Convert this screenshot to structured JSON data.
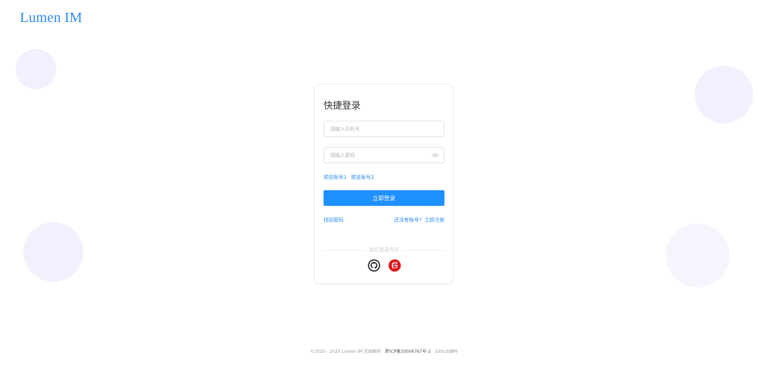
{
  "app": {
    "logo": "Lumen IM"
  },
  "login_card": {
    "title": "快捷登录",
    "phone_placeholder": "请输入手机号",
    "password_placeholder": "请输入密码",
    "preview_accounts": [
      "预览账号1",
      "预览账号2"
    ],
    "login_button": "立即登录",
    "forgot_password": "找回密码",
    "no_account": "还没有账号?",
    "register": "立即注册",
    "other_login": "其它登录方式",
    "social_icons": [
      "github-icon",
      "gitee-icon"
    ]
  },
  "footer": {
    "copyright": "©2020 - 2025 Lumen IM 在线聊天",
    "icp": "黔ICP备20006767号-2",
    "github": "Github源码"
  },
  "colors": {
    "accent": "#1e90ff",
    "link": "#2d8cf0",
    "bubble": "#f1f1fd",
    "gitee": "#e0141c",
    "github": "#24292f"
  }
}
